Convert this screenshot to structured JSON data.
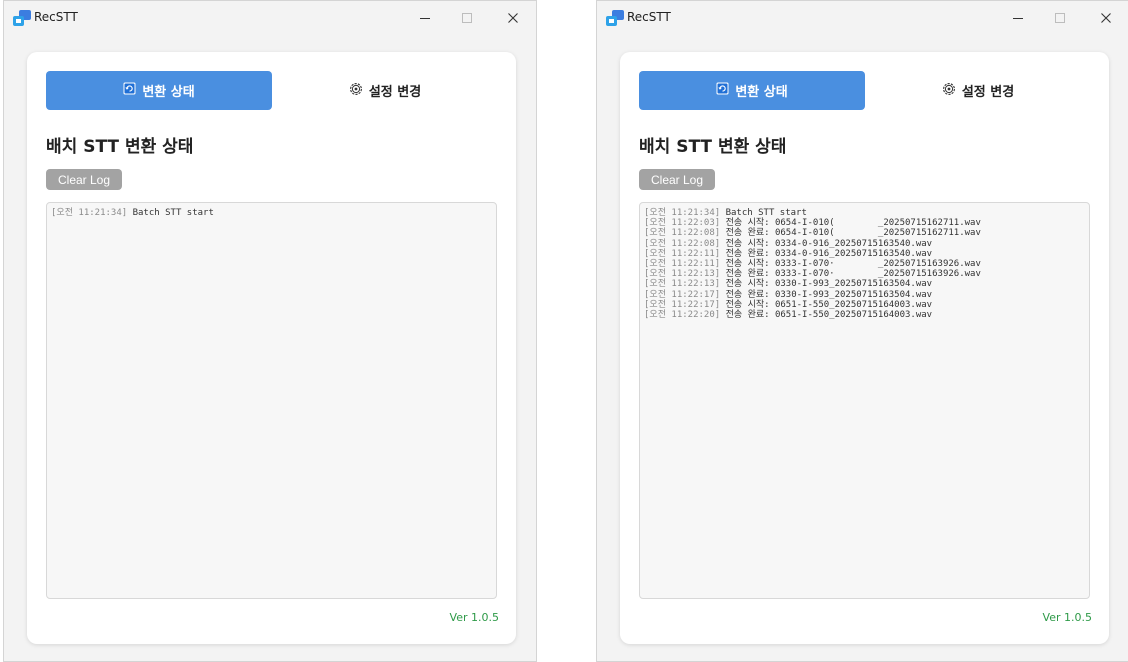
{
  "colors": {
    "accent": "#4a8fe0",
    "clear_button": "#a3a3a3",
    "version_text": "#2e9a48",
    "timestamp_text": "#8a8a8a"
  },
  "windows": [
    {
      "app_title": "RecSTT",
      "tabs": {
        "status_label": "변환 상태",
        "settings_label": "설정 변경"
      },
      "heading": "배치 STT 변환 상태",
      "clear_button_label": "Clear Log",
      "version": "Ver 1.0.5",
      "log": [
        {
          "ts": "[오전 11:21:34]",
          "msg": "Batch STT start"
        }
      ]
    },
    {
      "app_title": "RecSTT",
      "tabs": {
        "status_label": "변환 상태",
        "settings_label": "설정 변경"
      },
      "heading": "배치 STT 변환 상태",
      "clear_button_label": "Clear Log",
      "version": "Ver 1.0.5",
      "log": [
        {
          "ts": "[오전 11:21:34]",
          "msg": "Batch STT start"
        },
        {
          "ts": "[오전 11:22:03]",
          "msg": "전송 시작: 0654-I-010(        _20250715162711.wav"
        },
        {
          "ts": "[오전 11:22:08]",
          "msg": "전송 완료: 0654-I-010(        _20250715162711.wav"
        },
        {
          "ts": "[오전 11:22:08]",
          "msg": "전송 시작: 0334-0-916_20250715163540.wav"
        },
        {
          "ts": "[오전 11:22:11]",
          "msg": "전송 완료: 0334-0-916_20250715163540.wav"
        },
        {
          "ts": "[오전 11:22:11]",
          "msg": "전송 시작: 0333-I-070·        _20250715163926.wav"
        },
        {
          "ts": "[오전 11:22:13]",
          "msg": "전송 완료: 0333-I-070·        _20250715163926.wav"
        },
        {
          "ts": "[오전 11:22:13]",
          "msg": "전송 시작: 0330-I-993_20250715163504.wav"
        },
        {
          "ts": "[오전 11:22:17]",
          "msg": "전송 완료: 0330-I-993_20250715163504.wav"
        },
        {
          "ts": "[오전 11:22:17]",
          "msg": "전송 시작: 0651-I-550_20250715164003.wav"
        },
        {
          "ts": "[오전 11:22:20]",
          "msg": "전송 완료: 0651-I-550_20250715164003.wav"
        }
      ]
    }
  ]
}
